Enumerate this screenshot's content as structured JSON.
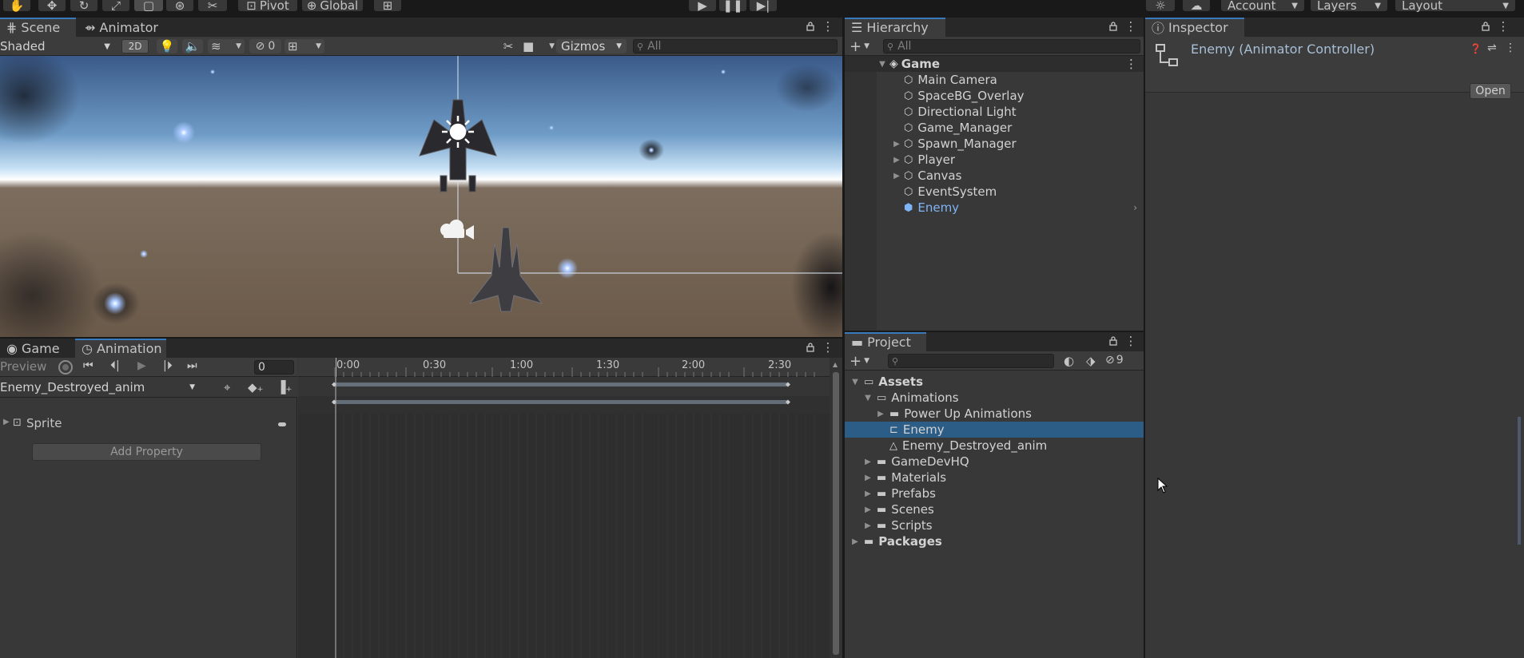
{
  "toolbar": {
    "pivot_label": "Pivot",
    "global_label": "Global",
    "account_label": "Account",
    "layers_label": "Layers",
    "layout_label": "Layout"
  },
  "scene": {
    "tabs": [
      "Scene",
      "Animator"
    ],
    "shading_mode": "Shaded",
    "toggle_2d": "2D",
    "hidden_count": "0",
    "gizmos_label": "Gizmos",
    "search_placeholder": "All"
  },
  "hierarchy": {
    "tab": "Hierarchy",
    "search_placeholder": "All",
    "scene_name": "Game",
    "items": [
      {
        "label": "Main Camera",
        "expandable": false
      },
      {
        "label": "SpaceBG_Overlay",
        "expandable": false
      },
      {
        "label": "Directional Light",
        "expandable": false
      },
      {
        "label": "Game_Manager",
        "expandable": false
      },
      {
        "label": "Spawn_Manager",
        "expandable": true
      },
      {
        "label": "Player",
        "expandable": true
      },
      {
        "label": "Canvas",
        "expandable": true
      },
      {
        "label": "EventSystem",
        "expandable": false
      },
      {
        "label": "Enemy",
        "expandable": false,
        "prefab": true
      }
    ]
  },
  "inspector": {
    "tab": "Inspector",
    "title": "Enemy (Animator Controller)",
    "open_button": "Open"
  },
  "animation": {
    "tabs": [
      "Game",
      "Animation"
    ],
    "preview_label": "Preview",
    "frame_value": "0",
    "clip_name": "Enemy_Destroyed_anim",
    "property": "Sprite",
    "add_property": "Add Property",
    "timeline_labels": [
      "0:00",
      "0:30",
      "1:00",
      "1:30",
      "2:00",
      "2:30"
    ]
  },
  "project": {
    "tab": "Project",
    "hidden_packages_count": "9",
    "tree": [
      {
        "label": "Assets",
        "depth": 0,
        "bold": true,
        "expanded": true,
        "kind": "folder-open"
      },
      {
        "label": "Animations",
        "depth": 1,
        "bold": false,
        "expanded": true,
        "kind": "folder-open"
      },
      {
        "label": "Power Up Animations",
        "depth": 2,
        "bold": false,
        "expanded": false,
        "kind": "folder"
      },
      {
        "label": "Enemy",
        "depth": 2,
        "bold": false,
        "selected": true,
        "kind": "animator-controller"
      },
      {
        "label": "Enemy_Destroyed_anim",
        "depth": 2,
        "bold": false,
        "kind": "animation-clip"
      },
      {
        "label": "GameDevHQ",
        "depth": 1,
        "bold": false,
        "expanded": false,
        "kind": "folder"
      },
      {
        "label": "Materials",
        "depth": 1,
        "bold": false,
        "expanded": false,
        "kind": "folder"
      },
      {
        "label": "Prefabs",
        "depth": 1,
        "bold": false,
        "expanded": false,
        "kind": "folder"
      },
      {
        "label": "Scenes",
        "depth": 1,
        "bold": false,
        "expanded": false,
        "kind": "folder"
      },
      {
        "label": "Scripts",
        "depth": 1,
        "bold": false,
        "expanded": false,
        "kind": "folder"
      },
      {
        "label": "Packages",
        "depth": 0,
        "bold": true,
        "expanded": false,
        "kind": "folder"
      }
    ]
  },
  "colors": {
    "selection": "#2c5d87",
    "accent": "#3a79bb",
    "panel": "#383838",
    "prefab_text": "#7fb4f5"
  }
}
